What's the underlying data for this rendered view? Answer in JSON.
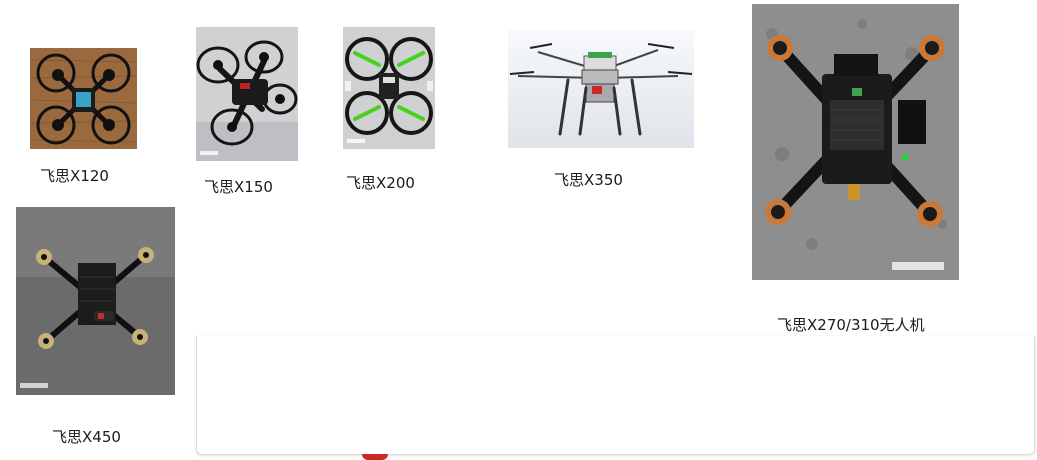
{
  "products": [
    {
      "caption": "飞思X120",
      "photo_icon": "drone-x120-photo"
    },
    {
      "caption": "飞思X150",
      "photo_icon": "drone-x150-photo"
    },
    {
      "caption": "飞思X200",
      "photo_icon": "drone-x200-photo"
    },
    {
      "caption": "飞思X350",
      "photo_icon": "drone-x350-render"
    },
    {
      "caption": "飞思X270/310无人机",
      "photo_icon": "drone-x270-310-photo"
    },
    {
      "caption": "飞思X450",
      "photo_icon": "drone-x450-photo"
    }
  ],
  "colors": {
    "wood": "#9a6a3e",
    "carbon": "#1d1d1d",
    "gray_floor": "#8e8e8e",
    "render_bg": "#eef2f5",
    "prop_green": "#46d11a",
    "card_accent": "#c82a2a"
  }
}
